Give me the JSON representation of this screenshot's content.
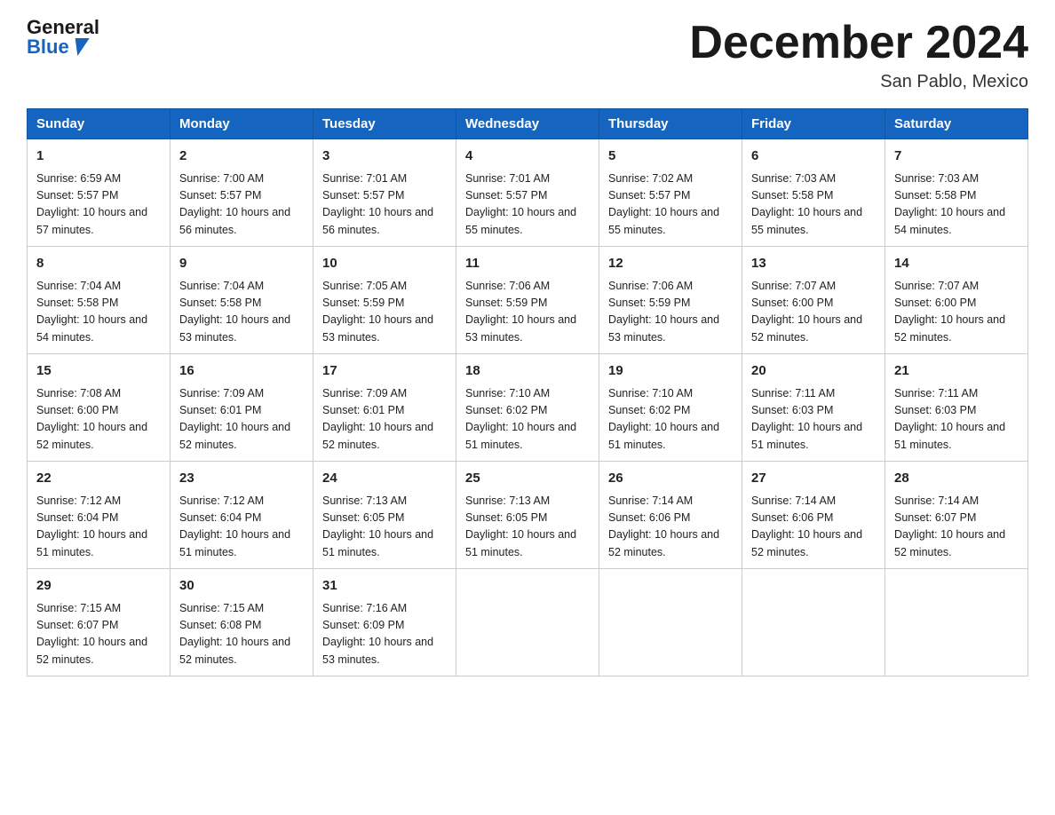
{
  "header": {
    "logo_general": "General",
    "logo_blue": "Blue",
    "month_title": "December 2024",
    "location": "San Pablo, Mexico"
  },
  "days_of_week": [
    "Sunday",
    "Monday",
    "Tuesday",
    "Wednesday",
    "Thursday",
    "Friday",
    "Saturday"
  ],
  "weeks": [
    [
      {
        "day": "1",
        "sunrise": "6:59 AM",
        "sunset": "5:57 PM",
        "daylight": "10 hours and 57 minutes."
      },
      {
        "day": "2",
        "sunrise": "7:00 AM",
        "sunset": "5:57 PM",
        "daylight": "10 hours and 56 minutes."
      },
      {
        "day": "3",
        "sunrise": "7:01 AM",
        "sunset": "5:57 PM",
        "daylight": "10 hours and 56 minutes."
      },
      {
        "day": "4",
        "sunrise": "7:01 AM",
        "sunset": "5:57 PM",
        "daylight": "10 hours and 55 minutes."
      },
      {
        "day": "5",
        "sunrise": "7:02 AM",
        "sunset": "5:57 PM",
        "daylight": "10 hours and 55 minutes."
      },
      {
        "day": "6",
        "sunrise": "7:03 AM",
        "sunset": "5:58 PM",
        "daylight": "10 hours and 55 minutes."
      },
      {
        "day": "7",
        "sunrise": "7:03 AM",
        "sunset": "5:58 PM",
        "daylight": "10 hours and 54 minutes."
      }
    ],
    [
      {
        "day": "8",
        "sunrise": "7:04 AM",
        "sunset": "5:58 PM",
        "daylight": "10 hours and 54 minutes."
      },
      {
        "day": "9",
        "sunrise": "7:04 AM",
        "sunset": "5:58 PM",
        "daylight": "10 hours and 53 minutes."
      },
      {
        "day": "10",
        "sunrise": "7:05 AM",
        "sunset": "5:59 PM",
        "daylight": "10 hours and 53 minutes."
      },
      {
        "day": "11",
        "sunrise": "7:06 AM",
        "sunset": "5:59 PM",
        "daylight": "10 hours and 53 minutes."
      },
      {
        "day": "12",
        "sunrise": "7:06 AM",
        "sunset": "5:59 PM",
        "daylight": "10 hours and 53 minutes."
      },
      {
        "day": "13",
        "sunrise": "7:07 AM",
        "sunset": "6:00 PM",
        "daylight": "10 hours and 52 minutes."
      },
      {
        "day": "14",
        "sunrise": "7:07 AM",
        "sunset": "6:00 PM",
        "daylight": "10 hours and 52 minutes."
      }
    ],
    [
      {
        "day": "15",
        "sunrise": "7:08 AM",
        "sunset": "6:00 PM",
        "daylight": "10 hours and 52 minutes."
      },
      {
        "day": "16",
        "sunrise": "7:09 AM",
        "sunset": "6:01 PM",
        "daylight": "10 hours and 52 minutes."
      },
      {
        "day": "17",
        "sunrise": "7:09 AM",
        "sunset": "6:01 PM",
        "daylight": "10 hours and 52 minutes."
      },
      {
        "day": "18",
        "sunrise": "7:10 AM",
        "sunset": "6:02 PM",
        "daylight": "10 hours and 51 minutes."
      },
      {
        "day": "19",
        "sunrise": "7:10 AM",
        "sunset": "6:02 PM",
        "daylight": "10 hours and 51 minutes."
      },
      {
        "day": "20",
        "sunrise": "7:11 AM",
        "sunset": "6:03 PM",
        "daylight": "10 hours and 51 minutes."
      },
      {
        "day": "21",
        "sunrise": "7:11 AM",
        "sunset": "6:03 PM",
        "daylight": "10 hours and 51 minutes."
      }
    ],
    [
      {
        "day": "22",
        "sunrise": "7:12 AM",
        "sunset": "6:04 PM",
        "daylight": "10 hours and 51 minutes."
      },
      {
        "day": "23",
        "sunrise": "7:12 AM",
        "sunset": "6:04 PM",
        "daylight": "10 hours and 51 minutes."
      },
      {
        "day": "24",
        "sunrise": "7:13 AM",
        "sunset": "6:05 PM",
        "daylight": "10 hours and 51 minutes."
      },
      {
        "day": "25",
        "sunrise": "7:13 AM",
        "sunset": "6:05 PM",
        "daylight": "10 hours and 51 minutes."
      },
      {
        "day": "26",
        "sunrise": "7:14 AM",
        "sunset": "6:06 PM",
        "daylight": "10 hours and 52 minutes."
      },
      {
        "day": "27",
        "sunrise": "7:14 AM",
        "sunset": "6:06 PM",
        "daylight": "10 hours and 52 minutes."
      },
      {
        "day": "28",
        "sunrise": "7:14 AM",
        "sunset": "6:07 PM",
        "daylight": "10 hours and 52 minutes."
      }
    ],
    [
      {
        "day": "29",
        "sunrise": "7:15 AM",
        "sunset": "6:07 PM",
        "daylight": "10 hours and 52 minutes."
      },
      {
        "day": "30",
        "sunrise": "7:15 AM",
        "sunset": "6:08 PM",
        "daylight": "10 hours and 52 minutes."
      },
      {
        "day": "31",
        "sunrise": "7:16 AM",
        "sunset": "6:09 PM",
        "daylight": "10 hours and 53 minutes."
      },
      null,
      null,
      null,
      null
    ]
  ]
}
